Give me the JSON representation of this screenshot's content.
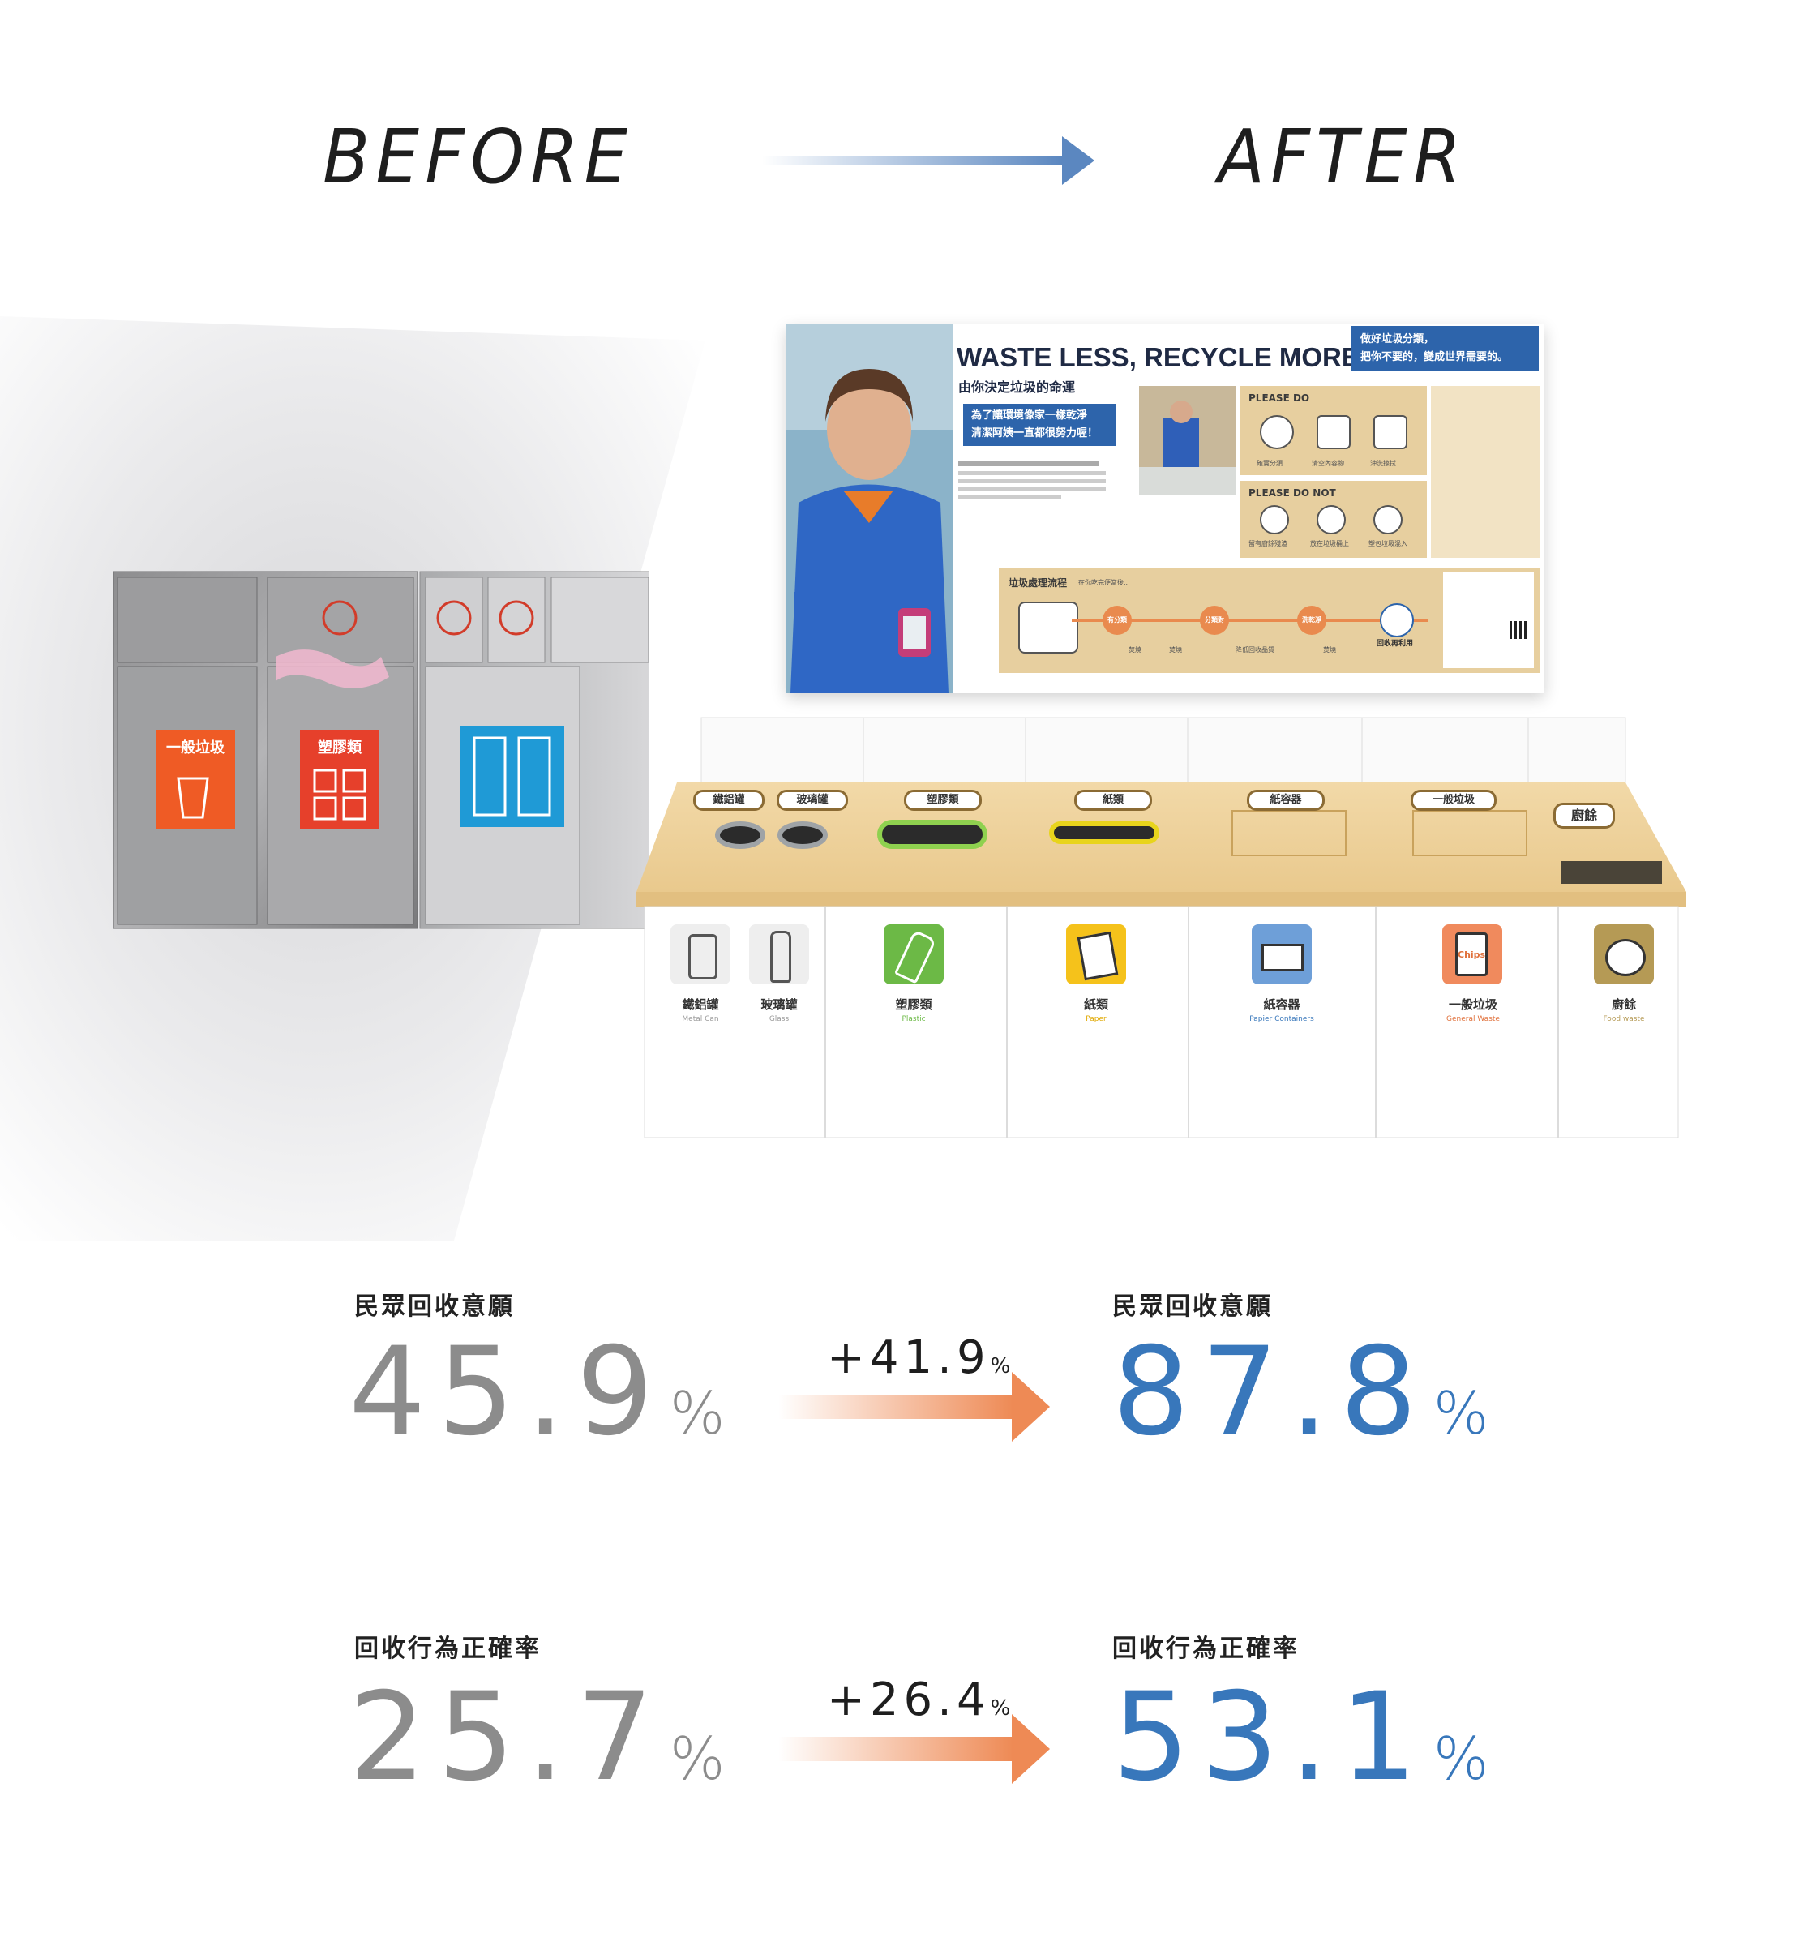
{
  "header": {
    "before": "BEFORE",
    "after": "AFTER"
  },
  "poster": {
    "title": "WASTE LESS, RECYCLE MORE",
    "subtitle": "由你決定垃圾的命運",
    "quote_left": "為了讓環境像家一樣乾淨\n清潔阿姨一直都很努力喔！",
    "quote_right": "做好垃圾分類，\n把你不要的，變成世界需要的。",
    "please_do": "PLEASE DO",
    "please_do_items": [
      "確實分類",
      "清空內容物",
      "沖洗擦拭"
    ],
    "please_do_not": "PLEASE DO NOT",
    "please_do_not_items": [
      "留有廚餘殘渣",
      "放在垃圾桶上",
      "塑包垃圾混入"
    ],
    "flow_title": "垃圾處理流程",
    "flow_subtitle": "在你吃完便當後...",
    "flow_steps": [
      "有分類",
      "分類對",
      "洗乾淨",
      "回收再利用"
    ],
    "flow_outcomes": [
      "焚燒",
      "焚燒",
      "降低回收品質",
      "焚燒"
    ]
  },
  "station": {
    "lids": [
      "鐵鋁罐",
      "玻璃罐",
      "塑膠類",
      "紙類",
      "紙容器",
      "一般垃圾",
      "廚餘"
    ],
    "cabinets": [
      {
        "zh": "鐵鋁罐",
        "en": "Metal Can",
        "color": "#eeeeee",
        "en_color": "#9a9a9a",
        "icon": "can-icon"
      },
      {
        "zh": "玻璃罐",
        "en": "Glass",
        "color": "#eeeeee",
        "en_color": "#9a9a9a",
        "icon": "bottle-icon"
      },
      {
        "zh": "塑膠類",
        "en": "Plastic",
        "color": "#6cb946",
        "en_color": "#6cb946",
        "icon": "plastic-bottle-icon"
      },
      {
        "zh": "紙類",
        "en": "Paper",
        "color": "#f5c21b",
        "en_color": "#e0a800",
        "icon": "paper-icon"
      },
      {
        "zh": "紙容器",
        "en": "Papier Containers",
        "color": "#6e9fd8",
        "en_color": "#3877bb",
        "icon": "box-icon"
      },
      {
        "zh": "一般垃圾",
        "en": "General Waste",
        "color": "#f08a5d",
        "en_color": "#e0703a",
        "icon": "chips-bag-icon"
      },
      {
        "zh": "廚餘",
        "en": "Food waste",
        "color": "#b59a55",
        "en_color": "#b59a55",
        "icon": "food-icon"
      }
    ],
    "chips_text": "Chips"
  },
  "before_bins": {
    "labels": [
      "一般垃圾",
      "塑膠類"
    ]
  },
  "stats": [
    {
      "label": "民眾回收意願",
      "before": "45.9",
      "after": "87.8",
      "delta": "+41.9",
      "unit": "%"
    },
    {
      "label": "回收行為正確率",
      "before": "25.7",
      "after": "53.1",
      "delta": "+26.4",
      "unit": "%"
    }
  ],
  "colors": {
    "before_value": "#8c8c8c",
    "after_value": "#3877bb",
    "arrow_top": "#5b87c0",
    "arrow_stats": "#ee8a55"
  }
}
